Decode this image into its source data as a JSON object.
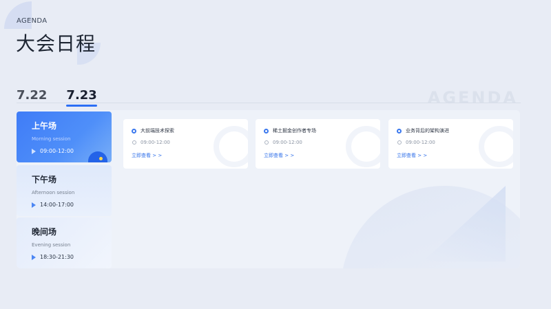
{
  "header": {
    "kicker": "AGENDA",
    "title": "大会日程",
    "watermark": "AGENDA"
  },
  "date_tabs": [
    {
      "label": "7.22",
      "active": false
    },
    {
      "label": "7.23",
      "active": true
    }
  ],
  "sessions": [
    {
      "name": "上午场",
      "sub": "Morning session",
      "time": "09:00-12:00",
      "active": true
    },
    {
      "name": "下午场",
      "sub": "Afternoon session",
      "time": "14:00-17:00",
      "active": false
    },
    {
      "name": "晚间场",
      "sub": "Evening session",
      "time": "18:30-21:30",
      "active": false
    }
  ],
  "cards": [
    {
      "title": "大前端技术探索",
      "time": "09:00-12:00",
      "link": "立即查看 > >"
    },
    {
      "title": "稀土掘金创作者专场",
      "time": "09:00-12:00",
      "link": "立即查看 > >"
    },
    {
      "title": "业务背后的架构演进",
      "time": "09:00-12:00",
      "link": "立即查看 > >"
    }
  ],
  "colors": {
    "accent": "#2b6ef5",
    "background": "#e8ecf5"
  }
}
